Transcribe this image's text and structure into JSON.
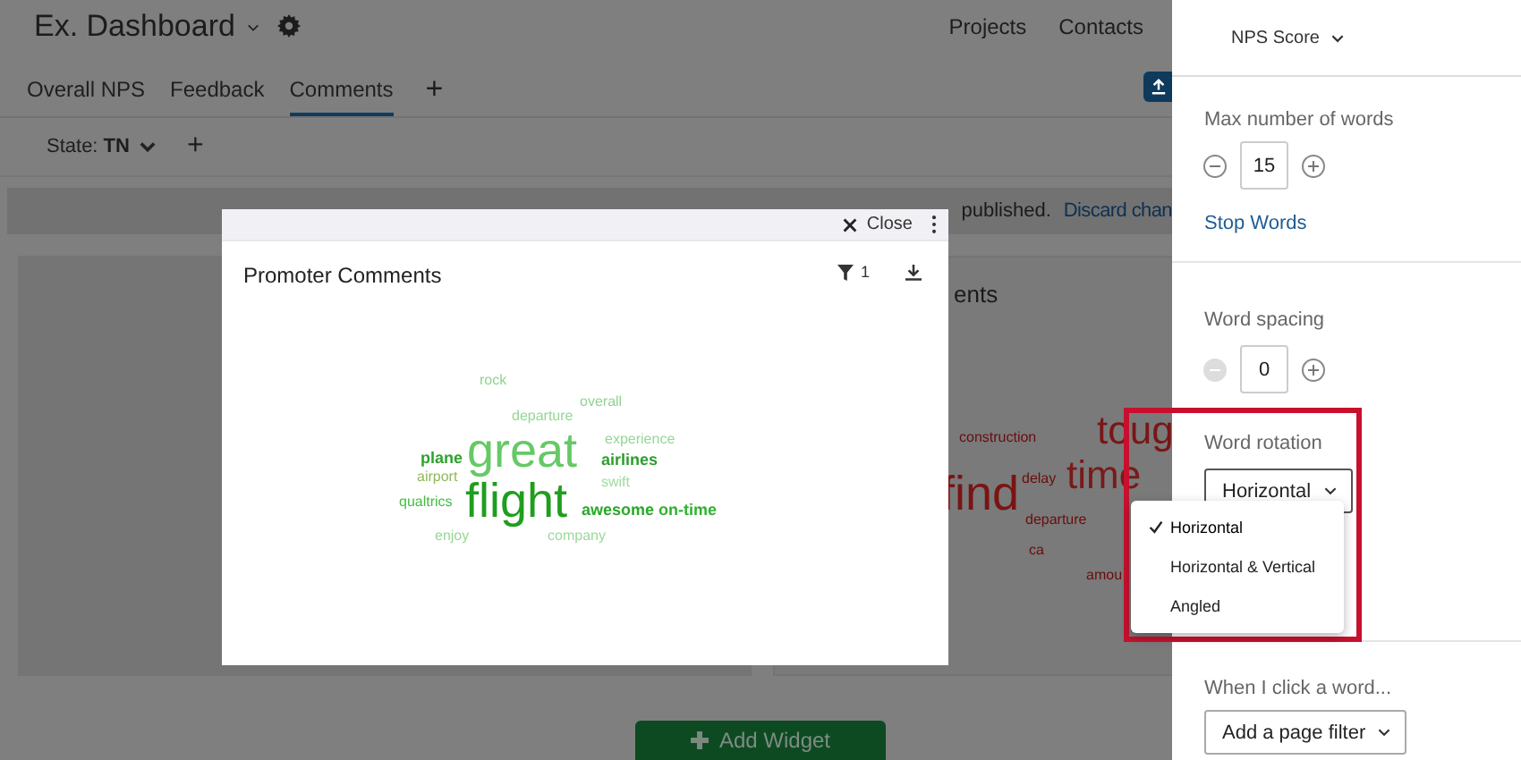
{
  "header": {
    "title": "Ex. Dashboard",
    "nav": [
      "Projects",
      "Contacts"
    ]
  },
  "tabs": [
    {
      "label": "Overall NPS",
      "selected": false
    },
    {
      "label": "Feedback",
      "selected": false
    },
    {
      "label": "Comments",
      "selected": true
    }
  ],
  "add_tab": "+",
  "filter": {
    "label": "State:",
    "value": "TN",
    "add": "+"
  },
  "banner": {
    "text": "published.",
    "link": "Discard chan"
  },
  "background_widget": {
    "title": "ents",
    "words": [
      {
        "text": "toug",
        "color": "#7a1616",
        "kind": "large"
      },
      {
        "text": "construction",
        "color": "#6a0c0c",
        "kind": "small"
      },
      {
        "text": "delay",
        "color": "#6a0c0c",
        "kind": "small"
      },
      {
        "text": "time",
        "color": "#7a1a1a",
        "kind": "large"
      },
      {
        "text": "find",
        "color": "#7a1414",
        "kind": "huge"
      },
      {
        "text": "departure",
        "color": "#6a0c0c",
        "kind": "small"
      },
      {
        "text": "ca",
        "color": "#6a0c0c",
        "kind": "small"
      },
      {
        "text": "amou",
        "color": "#6a0c0c",
        "kind": "small"
      }
    ]
  },
  "add_widget_button": "Add Widget",
  "modal": {
    "close": "Close",
    "title": "Promoter Comments",
    "filter_count": "1",
    "words": [
      {
        "text": "rock",
        "color": "#8fd48f",
        "kind": "small"
      },
      {
        "text": "overall",
        "color": "#8fd48f",
        "kind": "small"
      },
      {
        "text": "departure",
        "color": "#94d894",
        "kind": "small"
      },
      {
        "text": "experience",
        "color": "#94d894",
        "kind": "small"
      },
      {
        "text": "plane",
        "color": "#2ea32e",
        "kind": "medium"
      },
      {
        "text": "great",
        "color": "#66c966",
        "kind": "huge"
      },
      {
        "text": "airlines",
        "color": "#2e9e2e",
        "kind": "medium"
      },
      {
        "text": "airport",
        "color": "#8fb85a",
        "kind": "small"
      },
      {
        "text": "swift",
        "color": "#9edc9e",
        "kind": "small"
      },
      {
        "text": "qualtrics",
        "color": "#44bb44",
        "kind": "small"
      },
      {
        "text": "flight",
        "color": "#1f9e1f",
        "kind": "huge"
      },
      {
        "text": "awesome",
        "color": "#2aa82a",
        "kind": "medium"
      },
      {
        "text": "on-time",
        "color": "#33b033",
        "kind": "medium"
      },
      {
        "text": "enjoy",
        "color": "#94d894",
        "kind": "small"
      },
      {
        "text": "company",
        "color": "#9cd89c",
        "kind": "small"
      }
    ]
  },
  "panel": {
    "metric": "NPS Score",
    "max_words": {
      "label": "Max number of words",
      "value": "15",
      "decrement_disabled": false
    },
    "stop_words": "Stop Words",
    "word_spacing": {
      "label": "Word spacing",
      "value": "0",
      "decrement_disabled": true
    },
    "word_rotation": {
      "label": "Word rotation",
      "value": "Horizontal",
      "highlighted": true,
      "options": [
        {
          "label": "Horizontal",
          "selected": true
        },
        {
          "label": "Horizontal & Vertical",
          "selected": false
        },
        {
          "label": "Angled",
          "selected": false
        }
      ]
    },
    "click_action": {
      "label": "When I click a word...",
      "value": "Add a page filter"
    }
  }
}
